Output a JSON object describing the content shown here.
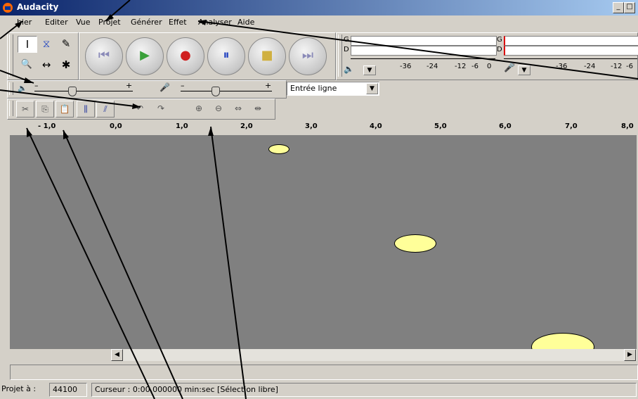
{
  "window": {
    "title": "Audacity",
    "controls": [
      "_",
      "□",
      "×"
    ]
  },
  "menu": {
    "items": [
      "Fichier",
      "Editer",
      "Vue",
      "Projet",
      "Générer",
      "Effet",
      "Analyser",
      "Aide"
    ],
    "first_visible": "hier"
  },
  "tools": {
    "selection": "I",
    "envelope": "⧖",
    "draw": "✎",
    "zoom": "🔍",
    "timeshift": "↔",
    "multi": "✱"
  },
  "transport": {
    "skip_start": "⏮",
    "play": "▶",
    "record": "●",
    "pause": "⏸",
    "stop": "■",
    "skip_end": "⏭"
  },
  "meters": {
    "out_left": "G",
    "out_right": "D",
    "in_left": "G",
    "in_right": "D",
    "scale_labels": [
      "-36",
      "-24",
      "-12",
      "-6",
      "0"
    ],
    "scale_labels_right": [
      "-36",
      "-24",
      "-12",
      "-6"
    ]
  },
  "mixer": {
    "output_minus": "–",
    "output_plus": "+",
    "input_minus": "–",
    "input_plus": "+",
    "output_level": 0.38,
    "input_level": 0.38,
    "input_source": "Entrée ligne"
  },
  "edit_toolbar": {
    "cut": "✂",
    "copy": "⎘",
    "paste": "📋",
    "trim": "⫼",
    "silence": "⫽",
    "undo": "↶",
    "redo": "↷",
    "zoom_in": "⊕",
    "zoom_out": "⊖",
    "fit_selection": "⇔",
    "fit_project": "⇹"
  },
  "ruler": {
    "labels": [
      "- 1,0",
      "0,0",
      "1,0",
      "2,0",
      "3,0",
      "4,0",
      "5,0",
      "6,0",
      "7,0",
      "8,0"
    ]
  },
  "status": {
    "project_rate_label": "Projet à :",
    "project_rate": "44100",
    "cursor_text": "Curseur : 0:00,000000 min:sec   [Sélection libre]"
  },
  "colors": {
    "title_bar_start": "#0a246a",
    "title_bar_end": "#a6caf0",
    "track_background": "#808080",
    "highlight_ellipse": "#ffff99",
    "window_face": "#d4d0c8"
  }
}
